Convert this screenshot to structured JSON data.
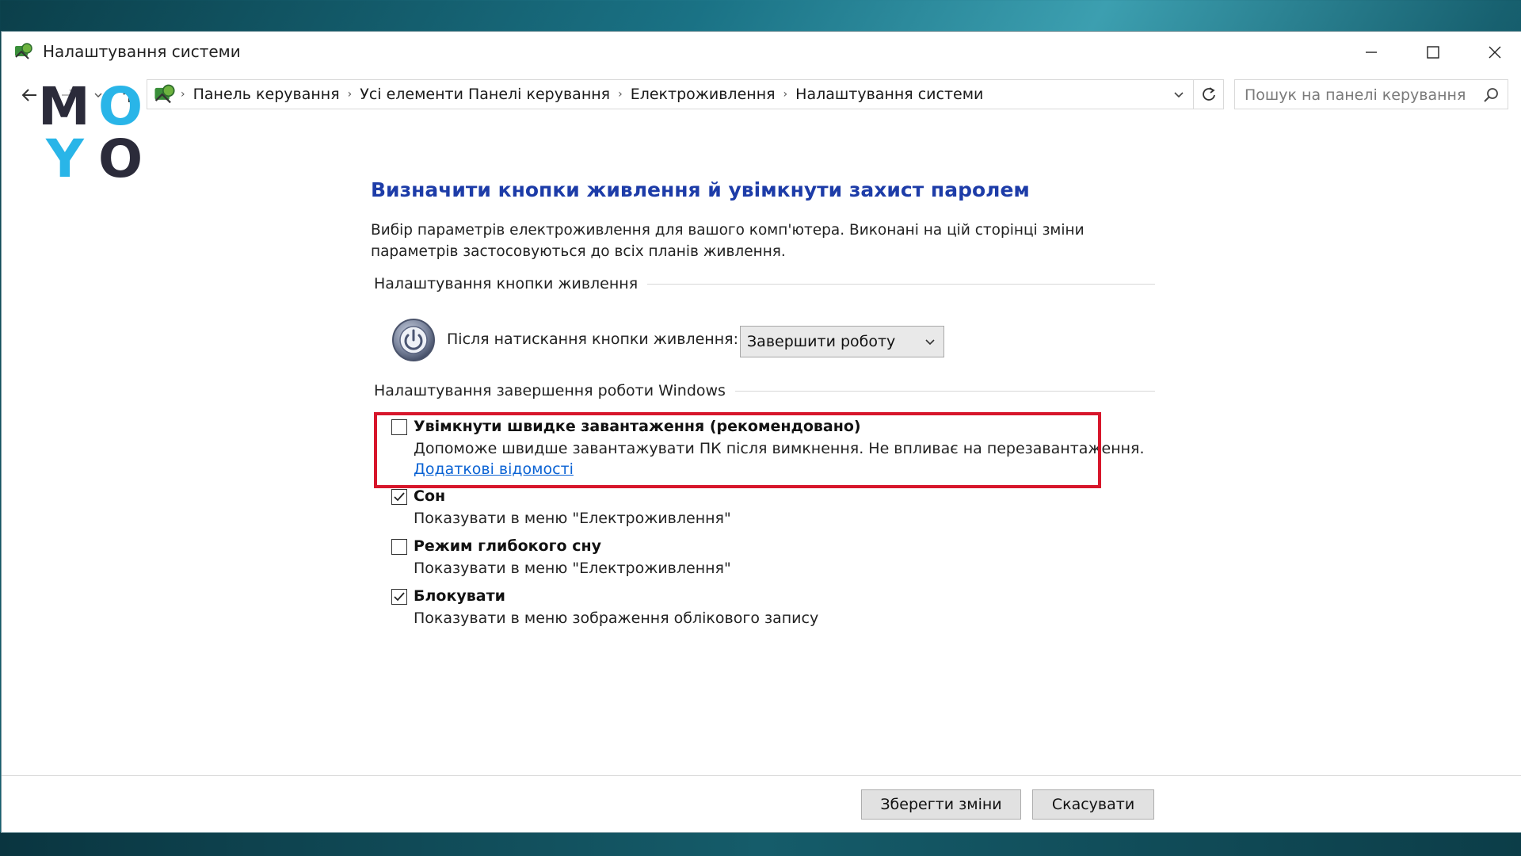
{
  "window": {
    "title": "Налаштування системи"
  },
  "logo": {
    "letters": [
      "M",
      "O",
      "Y",
      "O"
    ],
    "colors": [
      "#2b2b3a",
      "#29b5e8",
      "#29b5e8",
      "#2b2b3a"
    ]
  },
  "address_bar": {
    "breadcrumbs": [
      "Панель керування",
      "Усі елементи Панелі керування",
      "Електроживлення",
      "Налаштування системи"
    ],
    "search_placeholder": "Пошук на панелі керування"
  },
  "main": {
    "heading": "Визначити кнопки живлення й увімкнути захист паролем",
    "description": "Вибір параметрів електроживлення для вашого комп'ютера. Виконані на цій сторінці зміни параметрів застосовуються до всіх планів живлення.",
    "power_button_group": "Налаштування кнопки живлення",
    "power_button_label": "Після натискання кнопки живлення:",
    "power_button_value": "Завершити роботу",
    "shutdown_group": "Налаштування завершення роботи Windows",
    "options": [
      {
        "title": "Увімкнути швидке завантаження (рекомендовано)",
        "subtitle": "Допоможе швидше завантажувати ПК після вимкнення. Не впливає на перезавантаження.",
        "link": "Додаткові відомості",
        "checked": false
      },
      {
        "title": "Сон",
        "subtitle": "Показувати в меню \"Електроживлення\"",
        "checked": true
      },
      {
        "title": "Режим глибокого сну",
        "subtitle": "Показувати в меню \"Електроживлення\"",
        "checked": false
      },
      {
        "title": "Блокувати",
        "subtitle": "Показувати в меню зображення облікового запису",
        "checked": true
      }
    ]
  },
  "footer": {
    "save_label": "Зберегти зміни",
    "cancel_label": "Скасувати"
  },
  "colors": {
    "heading": "#1d3ca8",
    "link": "#0b63d4",
    "highlight": "#d7162b"
  }
}
